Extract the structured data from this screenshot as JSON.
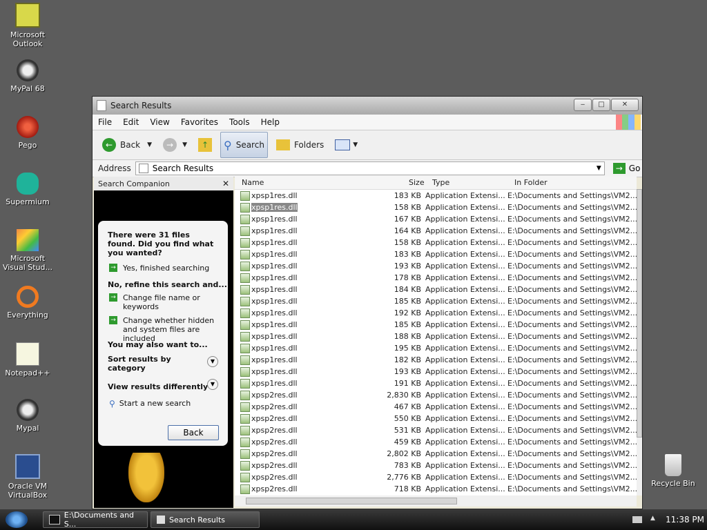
{
  "desktop": {
    "icons": [
      {
        "label": "Microsoft Outlook"
      },
      {
        "label": "MyPal 68"
      },
      {
        "label": "Pego"
      },
      {
        "label": "Supermium"
      },
      {
        "label": "Microsoft Visual Stud..."
      },
      {
        "label": "Everything"
      },
      {
        "label": "Notepad++"
      },
      {
        "label": "Mypal"
      },
      {
        "label": "Oracle VM VirtualBox"
      },
      {
        "label": "Recycle Bin"
      }
    ]
  },
  "window": {
    "title": "Search Results",
    "menu": [
      "File",
      "Edit",
      "View",
      "Favorites",
      "Tools",
      "Help"
    ],
    "toolbar": {
      "back": "Back",
      "search": "Search",
      "folders": "Folders"
    },
    "address": {
      "label": "Address",
      "value": "Search Results",
      "go": "Go"
    }
  },
  "companion": {
    "title": "Search Companion",
    "found": "There were 31 files found. Did you find what you wanted?",
    "yes": "Yes, finished searching",
    "refine": "No, refine this search and...",
    "change_name": "Change file name or keywords",
    "change_hidden": "Change whether hidden and system files are included",
    "also": "You may also want to...",
    "sort": "Sort results by category",
    "view": "View results differently",
    "new_search": "Start a new search",
    "back": "Back"
  },
  "table": {
    "headers": [
      "Name",
      "Size",
      "Type",
      "In Folder"
    ],
    "rows": [
      [
        "xpsp1res.dll",
        "183 KB",
        "Application Extensi...",
        "E:\\Documents and Settings\\VM2..."
      ],
      [
        "xpsp1res.dll",
        "158 KB",
        "Application Extensi...",
        "E:\\Documents and Settings\\VM2..."
      ],
      [
        "xpsp1res.dll",
        "167 KB",
        "Application Extensi...",
        "E:\\Documents and Settings\\VM2..."
      ],
      [
        "xpsp1res.dll",
        "164 KB",
        "Application Extensi...",
        "E:\\Documents and Settings\\VM2..."
      ],
      [
        "xpsp1res.dll",
        "158 KB",
        "Application Extensi...",
        "E:\\Documents and Settings\\VM2..."
      ],
      [
        "xpsp1res.dll",
        "183 KB",
        "Application Extensi...",
        "E:\\Documents and Settings\\VM2..."
      ],
      [
        "xpsp1res.dll",
        "193 KB",
        "Application Extensi...",
        "E:\\Documents and Settings\\VM2..."
      ],
      [
        "xpsp1res.dll",
        "178 KB",
        "Application Extensi...",
        "E:\\Documents and Settings\\VM2..."
      ],
      [
        "xpsp1res.dll",
        "184 KB",
        "Application Extensi...",
        "E:\\Documents and Settings\\VM2..."
      ],
      [
        "xpsp1res.dll",
        "185 KB",
        "Application Extensi...",
        "E:\\Documents and Settings\\VM2..."
      ],
      [
        "xpsp1res.dll",
        "192 KB",
        "Application Extensi...",
        "E:\\Documents and Settings\\VM2..."
      ],
      [
        "xpsp1res.dll",
        "185 KB",
        "Application Extensi...",
        "E:\\Documents and Settings\\VM2..."
      ],
      [
        "xpsp1res.dll",
        "188 KB",
        "Application Extensi...",
        "E:\\Documents and Settings\\VM2..."
      ],
      [
        "xpsp1res.dll",
        "195 KB",
        "Application Extensi...",
        "E:\\Documents and Settings\\VM2..."
      ],
      [
        "xpsp1res.dll",
        "182 KB",
        "Application Extensi...",
        "E:\\Documents and Settings\\VM2..."
      ],
      [
        "xpsp1res.dll",
        "193 KB",
        "Application Extensi...",
        "E:\\Documents and Settings\\VM2..."
      ],
      [
        "xpsp1res.dll",
        "191 KB",
        "Application Extensi...",
        "E:\\Documents and Settings\\VM2..."
      ],
      [
        "xpsp2res.dll",
        "2,830 KB",
        "Application Extensi...",
        "E:\\Documents and Settings\\VM2..."
      ],
      [
        "xpsp2res.dll",
        "467 KB",
        "Application Extensi...",
        "E:\\Documents and Settings\\VM2..."
      ],
      [
        "xpsp2res.dll",
        "550 KB",
        "Application Extensi...",
        "E:\\Documents and Settings\\VM2..."
      ],
      [
        "xpsp2res.dll",
        "531 KB",
        "Application Extensi...",
        "E:\\Documents and Settings\\VM2..."
      ],
      [
        "xpsp2res.dll",
        "459 KB",
        "Application Extensi...",
        "E:\\Documents and Settings\\VM2..."
      ],
      [
        "xpsp2res.dll",
        "2,802 KB",
        "Application Extensi...",
        "E:\\Documents and Settings\\VM2..."
      ],
      [
        "xpsp2res.dll",
        "783 KB",
        "Application Extensi...",
        "E:\\Documents and Settings\\VM2..."
      ],
      [
        "xpsp2res.dll",
        "2,776 KB",
        "Application Extensi...",
        "E:\\Documents and Settings\\VM2..."
      ],
      [
        "xpsp2res.dll",
        "718 KB",
        "Application Extensi...",
        "E:\\Documents and Settings\\VM2..."
      ]
    ]
  },
  "taskbar": {
    "task1": "E:\\Documents and S...",
    "task2": "Search Results",
    "clock": "11:38 PM"
  }
}
